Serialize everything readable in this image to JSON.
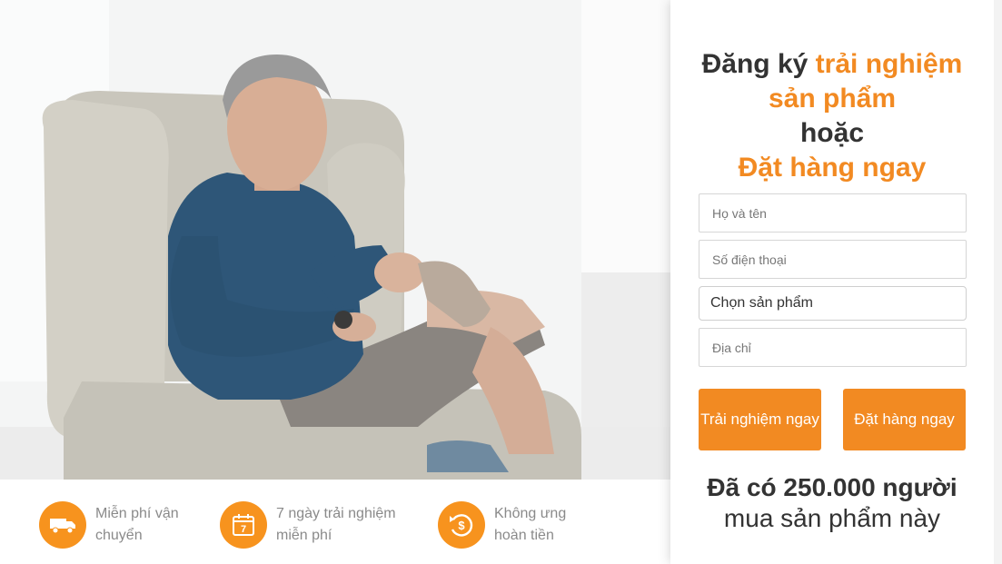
{
  "hero": {
    "image": "man-sitting-in-armchair-holding-device"
  },
  "benefits": [
    {
      "icon": "delivery-truck-icon",
      "line1": "Miễn phí vận",
      "line2": "chuyển"
    },
    {
      "icon": "calendar-7-icon",
      "line1": "7 ngày trải nghiệm",
      "line2": "miễn phí"
    },
    {
      "icon": "money-back-icon",
      "line1": "Không ưng",
      "line2": "hoàn tiền"
    }
  ],
  "form": {
    "heading": {
      "part1": "Đăng ký ",
      "part2": "trải nghiệm",
      "part3": "sản phẩm",
      "part4": "hoặc",
      "part5": "Đặt hàng ngay"
    },
    "name_placeholder": "Họ và tên",
    "phone_placeholder": "Số điện thoại",
    "product_select": "Chọn sản phẩm",
    "address_placeholder": "Địa chỉ",
    "trial_button": "Trải nghiệm ngay",
    "order_button": "Đặt hàng ngay",
    "count_line1": "Đã có 250.000 người",
    "count_line2": "mua sản phẩm này"
  },
  "colors": {
    "accent": "#f28a22",
    "text": "#333333"
  }
}
